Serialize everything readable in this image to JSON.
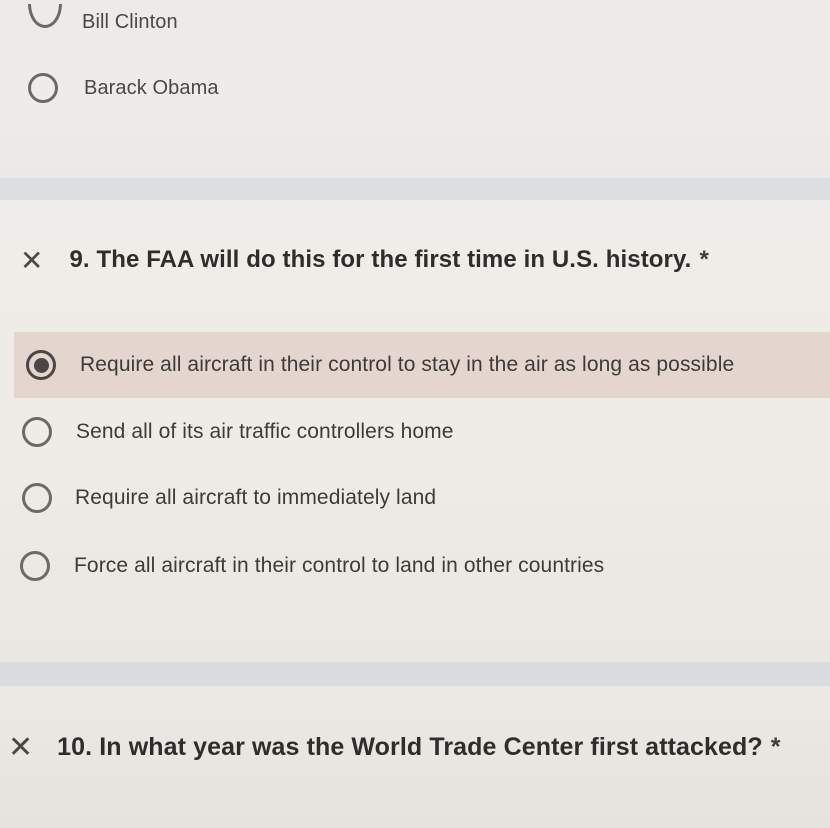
{
  "question8": {
    "options": [
      {
        "label": "Bill Clinton",
        "selected": false
      },
      {
        "label": "Barack Obama",
        "selected": false
      }
    ]
  },
  "question9": {
    "status_icon": "close-icon",
    "title": "9. The FAA will do this for the first time in U.S. history.",
    "required_marker": "*",
    "options": [
      {
        "label": "Require all aircraft in their control to stay in the air as long as possible",
        "selected": true
      },
      {
        "label": "Send all of its air traffic controllers home",
        "selected": false
      },
      {
        "label": "Require all aircraft to immediately land",
        "selected": false
      },
      {
        "label": "Force all aircraft in their control to land in other countries",
        "selected": false
      }
    ],
    "x_mark": "✕"
  },
  "question10": {
    "status_icon": "close-icon",
    "title": "10. In what year was the World Trade Center first attacked?",
    "required_marker": "*",
    "x_mark": "✕"
  },
  "colors": {
    "card_background": "#efede9",
    "separator": "#dcdfe1",
    "selected_option_background": "#e5d5cf",
    "text": "#3d3b3a"
  }
}
